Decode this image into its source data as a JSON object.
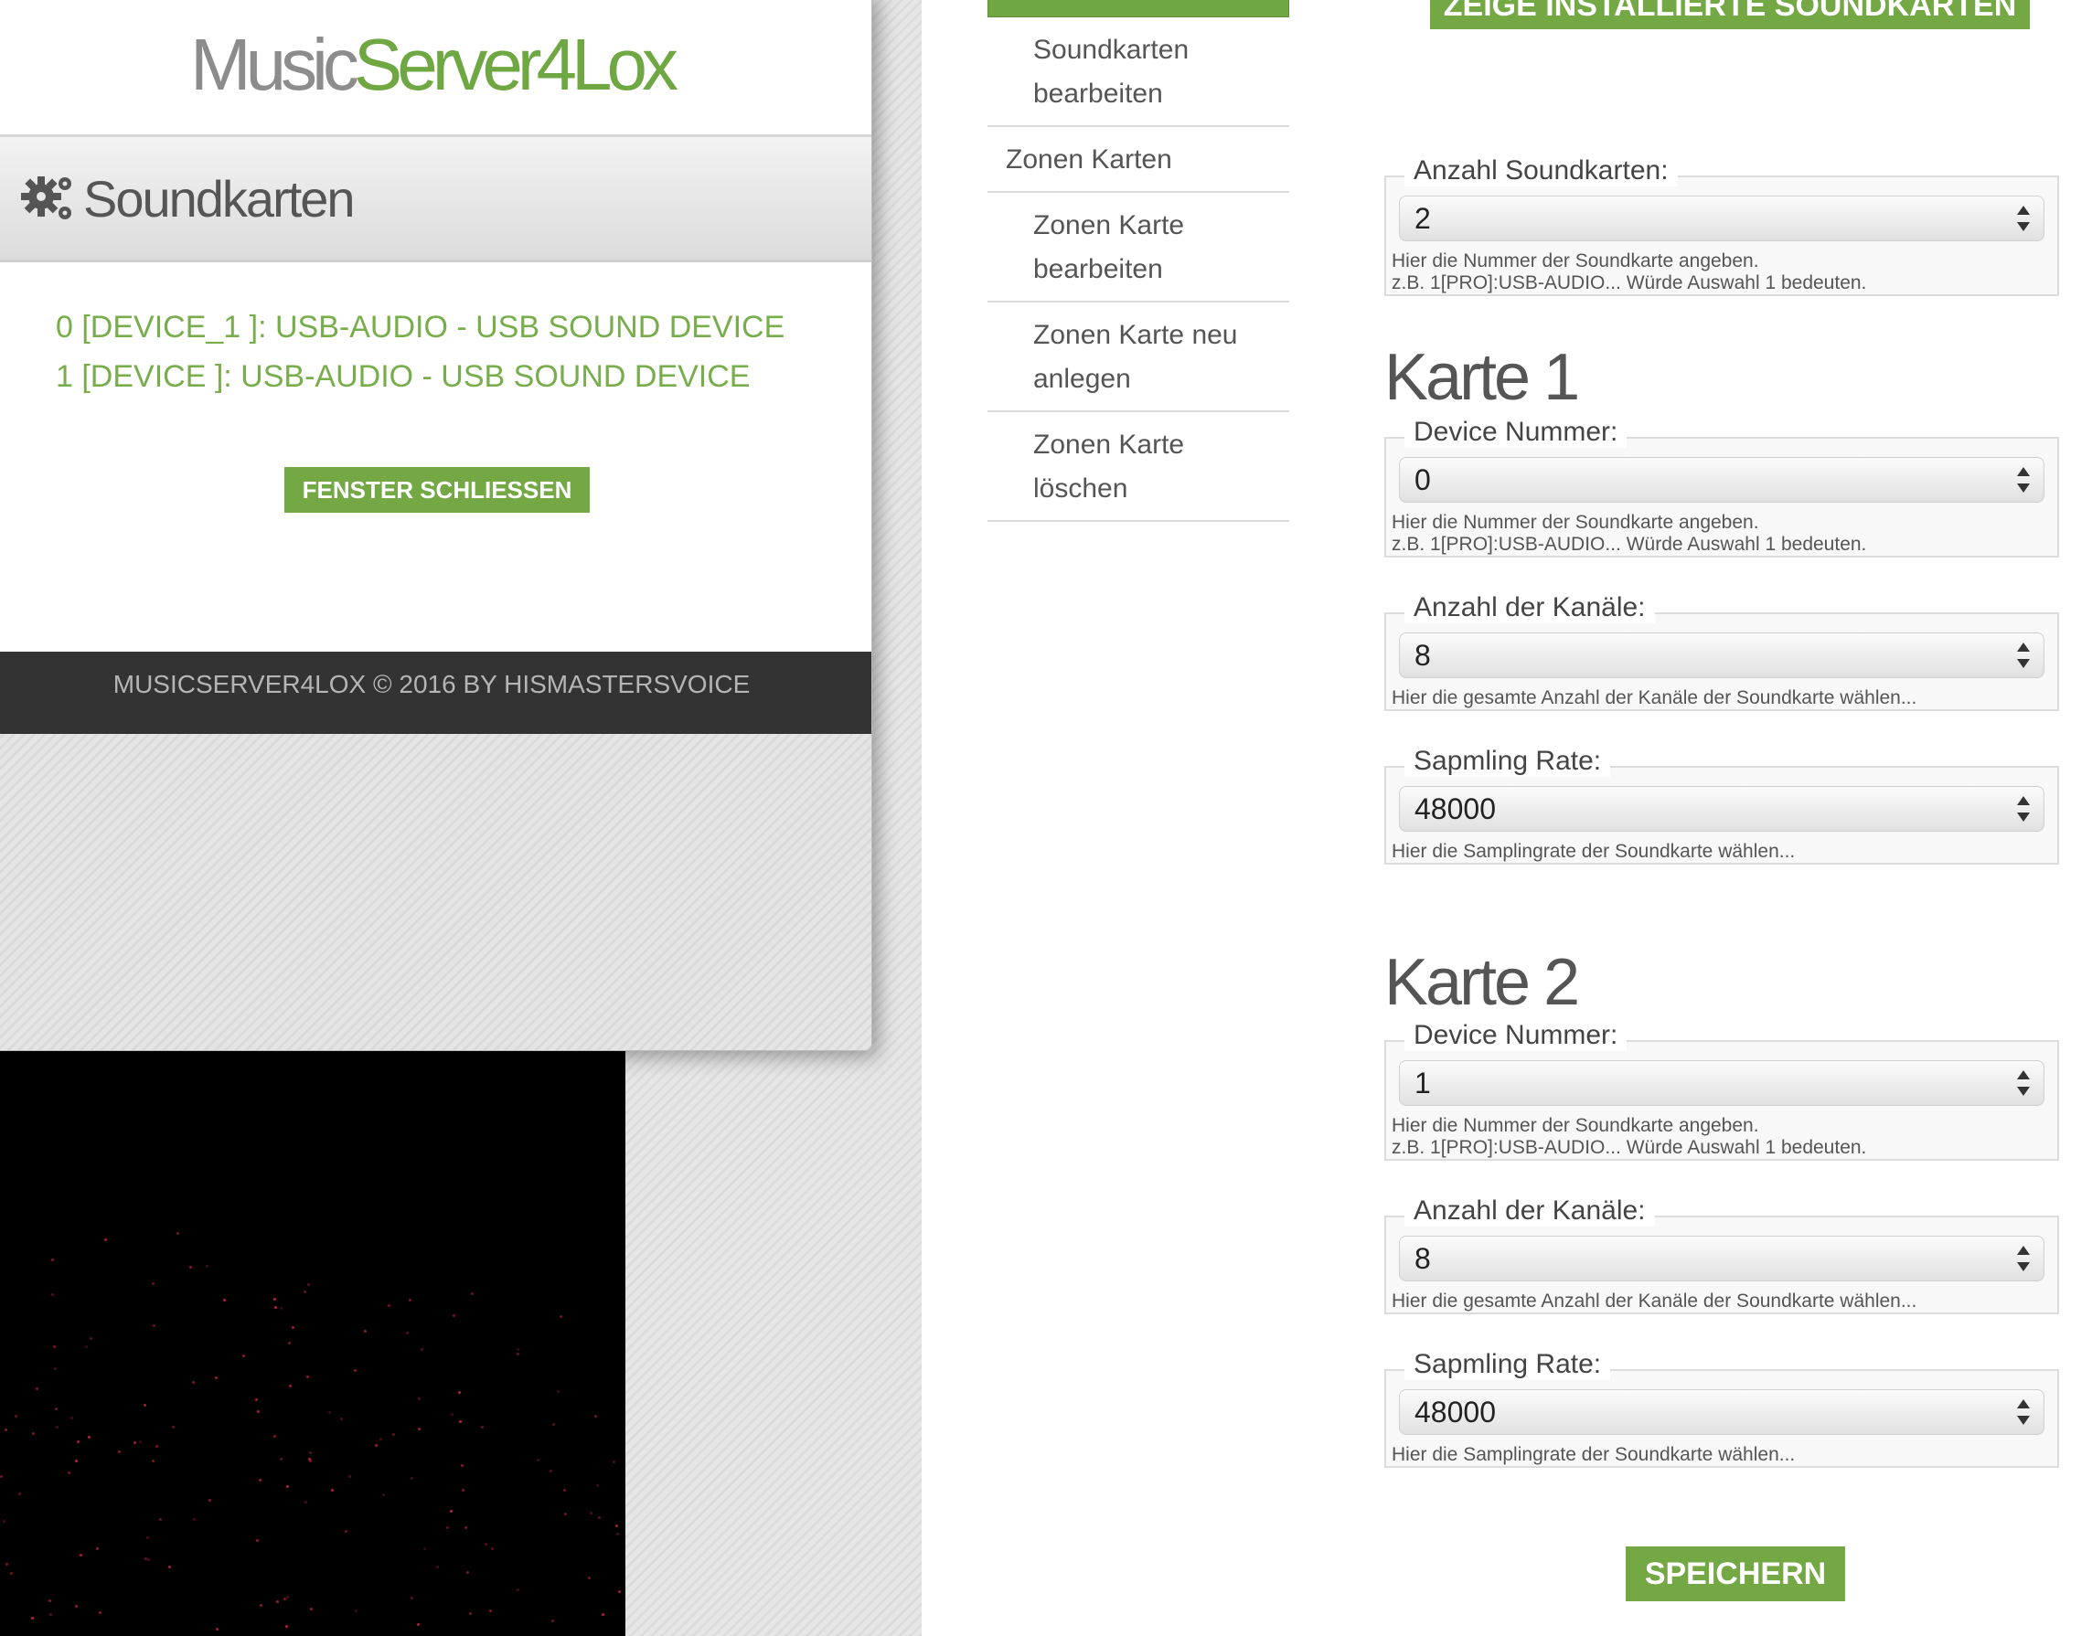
{
  "popup": {
    "logo_part1": "Music",
    "logo_part2": "Server4Lox",
    "title": "Soundkarten",
    "devices": [
      "0 [DEVICE_1 ]: USB-AUDIO - USB SOUND DEVICE",
      "1 [DEVICE ]: USB-AUDIO - USB SOUND DEVICE"
    ],
    "close_label": "FENSTER SCHLIESSEN",
    "footer": "MUSICSERVER4LOX © 2016 BY HISMASTERSVOICE"
  },
  "nav": {
    "items": [
      {
        "label_line1": "Soundkarten",
        "label_line2": "bearbeiten"
      },
      {
        "label_line1": "Zonen Karten"
      },
      {
        "label_line1": "Zonen Karte",
        "label_line2": "bearbeiten"
      },
      {
        "label_line1": "Zonen Karte neu",
        "label_line2": "anlegen"
      },
      {
        "label_line1": "Zonen Karte",
        "label_line2": "löschen"
      }
    ]
  },
  "top_button": "ZEIGE INSTALLIERTE SOUNDKARTEN",
  "anzahl": {
    "legend": "Anzahl Soundkarten:",
    "value": "2",
    "hint1": "Hier die Nummer der Soundkarte angeben.",
    "hint2": "z.B. 1[PRO]:USB-AUDIO... Würde Auswahl 1 bedeuten."
  },
  "karte1": {
    "title": "Karte 1",
    "device": {
      "legend": "Device Nummer:",
      "value": "0",
      "hint1": "Hier die Nummer der Soundkarte angeben.",
      "hint2": "z.B. 1[PRO]:USB-AUDIO... Würde Auswahl 1 bedeuten."
    },
    "channels": {
      "legend": "Anzahl der Kanäle:",
      "value": "8",
      "hint1": "Hier die gesamte Anzahl der Kanäle der Soundkarte wählen..."
    },
    "rate": {
      "legend": "Sapmling Rate:",
      "value": "48000",
      "hint1": "Hier die Samplingrate der Soundkarte wählen..."
    }
  },
  "karte2": {
    "title": "Karte 2",
    "device": {
      "legend": "Device Nummer:",
      "value": "1",
      "hint1": "Hier die Nummer der Soundkarte angeben.",
      "hint2": "z.B. 1[PRO]:USB-AUDIO... Würde Auswahl 1 bedeuten."
    },
    "channels": {
      "legend": "Anzahl der Kanäle:",
      "value": "8",
      "hint1": "Hier die gesamte Anzahl der Kanäle der Soundkarte wählen..."
    },
    "rate": {
      "legend": "Sapmling Rate:",
      "value": "48000",
      "hint1": "Hier die Samplingrate der Soundkarte wählen..."
    }
  },
  "save_label": "SPEICHERN",
  "colors": {
    "accent": "#73a844",
    "logo_gray": "#8c8c8c",
    "footer_bg": "#333333"
  }
}
